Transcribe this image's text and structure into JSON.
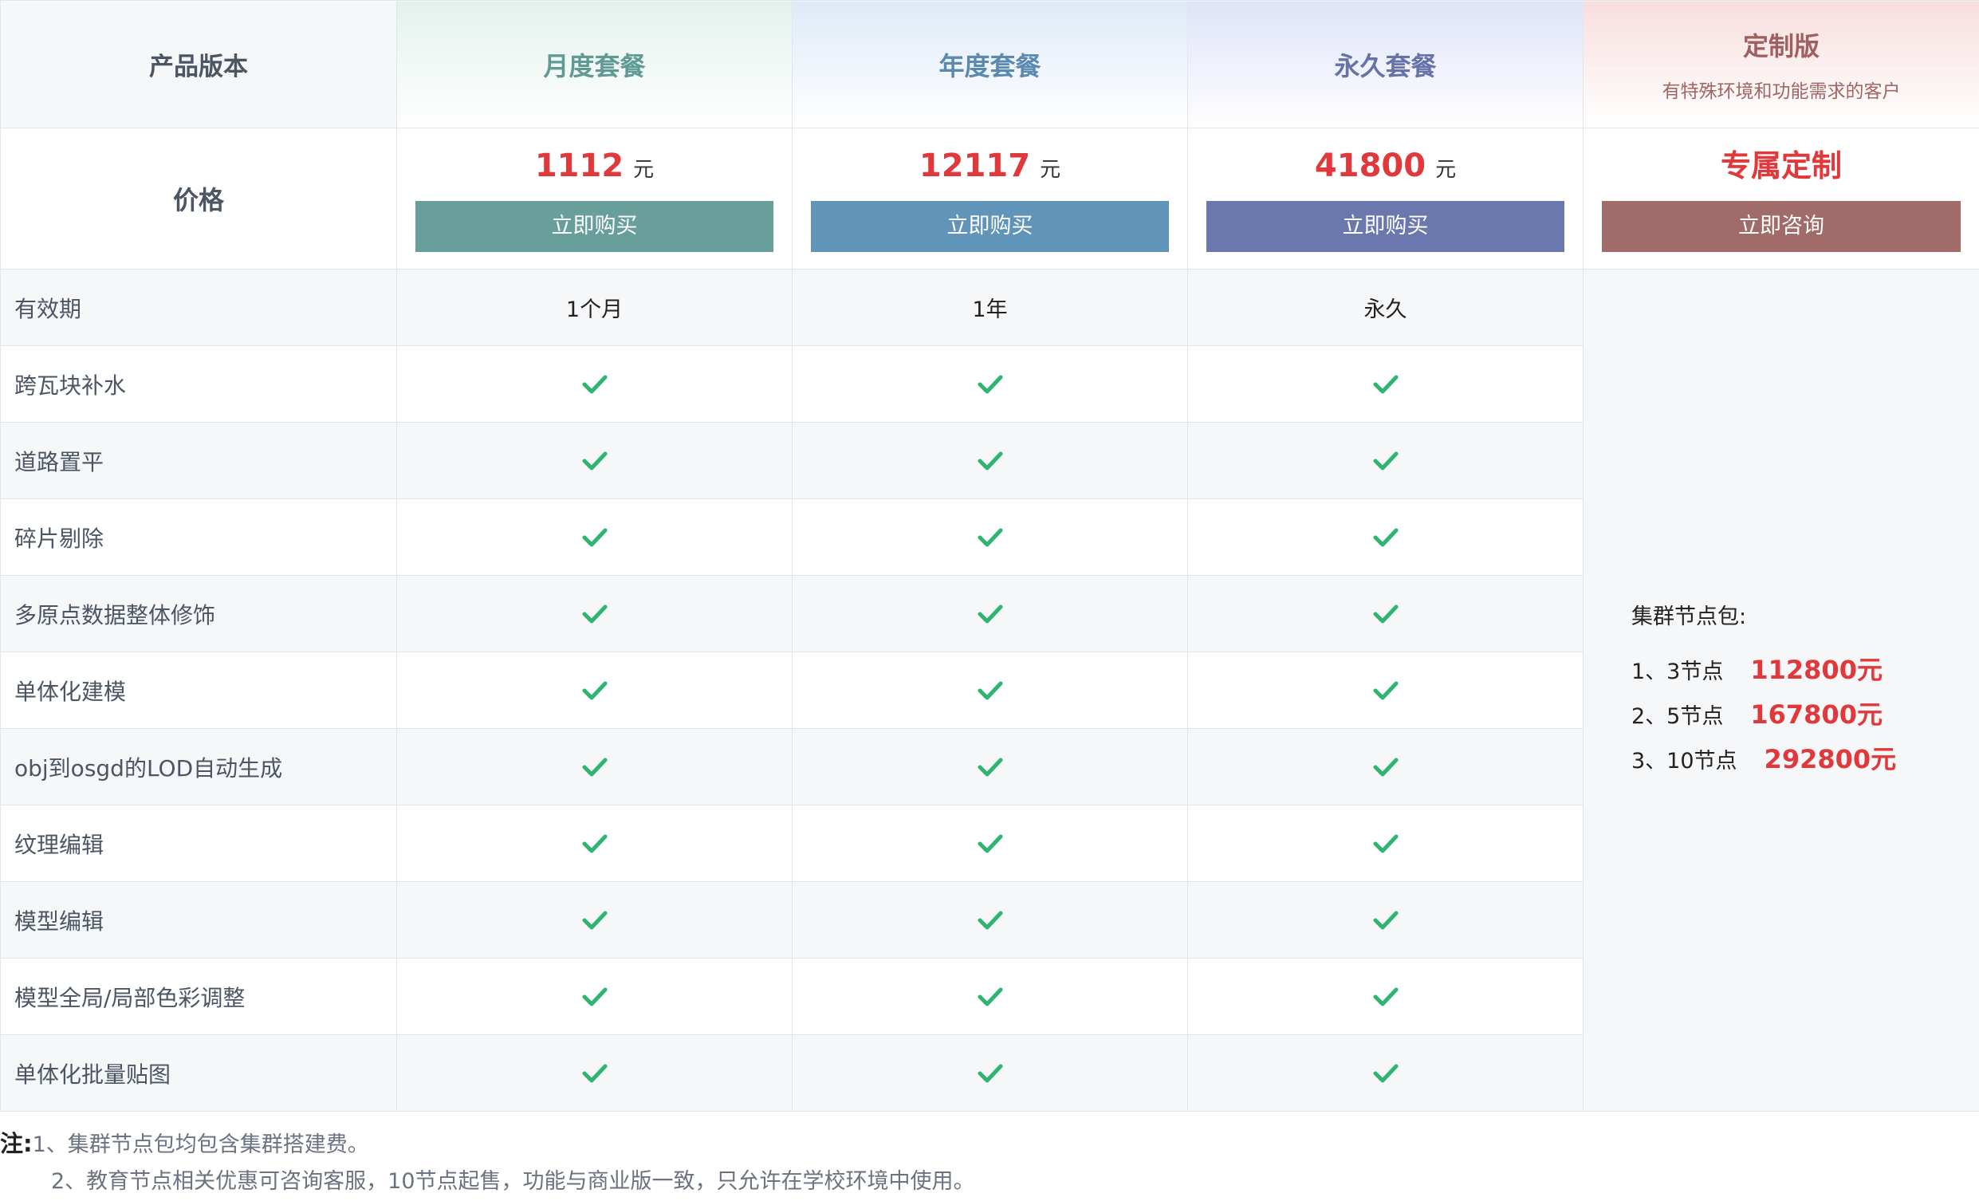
{
  "header": {
    "label": "产品版本",
    "plans": [
      {
        "name": "月度套餐"
      },
      {
        "name": "年度套餐"
      },
      {
        "name": "永久套餐"
      }
    ],
    "custom": {
      "name": "定制版",
      "subtitle": "有特殊环境和功能需求的客户"
    }
  },
  "price_row": {
    "label": "价格",
    "plans": [
      {
        "amount": "1112",
        "unit": "元",
        "button": "立即购买",
        "color": "#689f9a"
      },
      {
        "amount": "12117",
        "unit": "元",
        "button": "立即购买",
        "color": "#6094b9"
      },
      {
        "amount": "41800",
        "unit": "元",
        "button": "立即购买",
        "color": "#6a78ae"
      }
    ],
    "custom": {
      "title": "专属定制",
      "button": "立即咨询",
      "color": "#a06b69"
    }
  },
  "validity": {
    "label": "有效期",
    "values": [
      "1个月",
      "1年",
      "永久"
    ]
  },
  "features": [
    "跨瓦块补水",
    "道路置平",
    "碎片剔除",
    "多原点数据整体修饰",
    "单体化建模",
    "obj到osgd的LOD自动生成",
    "纹理编辑",
    "模型编辑",
    "模型全局/局部色彩调整",
    "单体化批量贴图"
  ],
  "check_icon": "check-icon",
  "check_color": "#2fb473",
  "cluster": {
    "title": "集群节点包:",
    "items": [
      {
        "label": "1、3节点",
        "price": "112800元"
      },
      {
        "label": "2、5节点",
        "price": "167800元"
      },
      {
        "label": "3、10节点",
        "price": "292800元"
      }
    ]
  },
  "notes": {
    "label": "注:",
    "lines": [
      "1、集群节点包均包含集群搭建费。",
      "2、教育节点相关优惠可咨询客服，10节点起售，功能与商业版一致，只允许在学校环境中使用。"
    ]
  }
}
